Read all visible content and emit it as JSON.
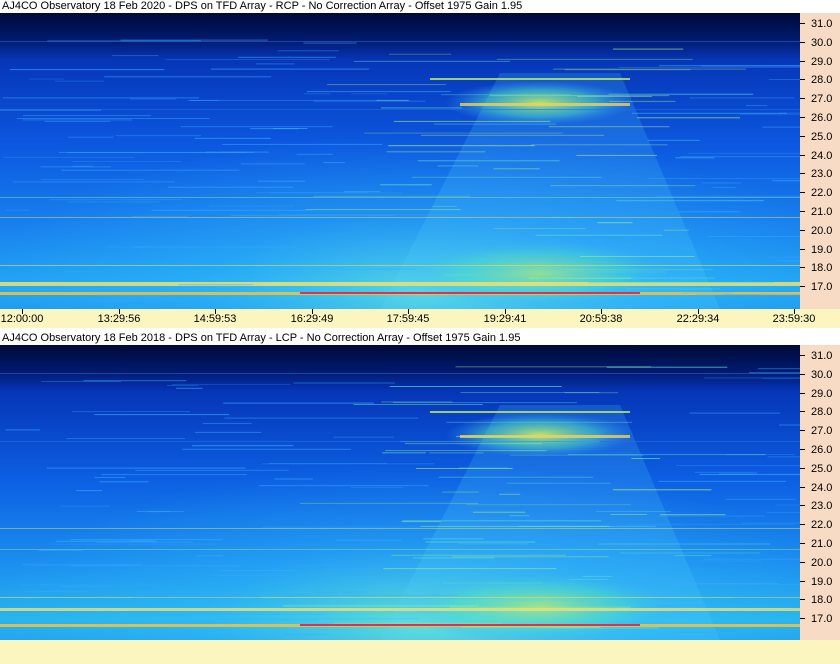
{
  "top_panel": {
    "title": "AJ4CO Observatory 18 Feb 2020 - DPS on TFD Array  - RCP  -  No Correction Array  -  Offset 1975  Gain 1.95",
    "y_ticks": [
      "31.0",
      "30.0",
      "29.0",
      "28.0",
      "27.0",
      "26.0",
      "25.0",
      "24.0",
      "23.0",
      "22.0",
      "21.0",
      "20.0",
      "19.0",
      "18.0",
      "17.0"
    ]
  },
  "time_axis": {
    "ticks": [
      "12:00:00",
      "13:29:56",
      "14:59:53",
      "16:29:49",
      "17:59:45",
      "19:29:41",
      "20:59:38",
      "22:29:34",
      "23:59:30"
    ]
  },
  "bottom_panel": {
    "title": "AJ4CO Observatory 18 Feb 2018 - DPS on TFD Array  - LCP  -  No Correction Array  -  Offset 1975  Gain 1.95",
    "y_ticks": [
      "31.0",
      "30.0",
      "29.0",
      "28.0",
      "27.0",
      "26.0",
      "25.0",
      "24.0",
      "23.0",
      "22.0",
      "21.0",
      "20.0",
      "19.0",
      "18.0",
      "17.0"
    ]
  },
  "colors": {
    "background_dark": "#000c40",
    "spectrum_blue": "#0a3fd0",
    "spectrum_cyan": "#2aa0ff",
    "spectrum_green": "#6fe8a0",
    "band_yellow": "#f0e070",
    "band_red": "#e03050",
    "axis_y_bg": "#f7dbc4",
    "axis_x_bg": "#fbf5c0"
  }
}
